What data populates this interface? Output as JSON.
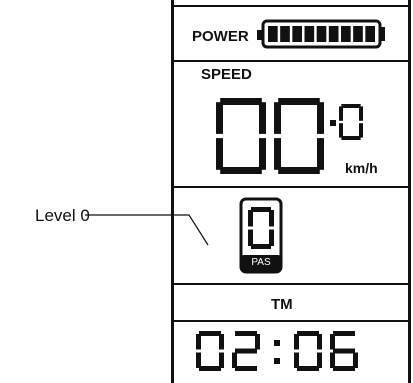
{
  "power": {
    "label": "POWER",
    "bar_segments": 9,
    "level_fraction": 1.0
  },
  "speed": {
    "label": "SPEED",
    "integer_digits": "00",
    "decimal_digit": "0",
    "unit": "km/h"
  },
  "pas": {
    "digit": "0",
    "label": "PAS"
  },
  "callout": {
    "text": "Level 0"
  },
  "trip_time": {
    "label": "TM",
    "hours": "02",
    "separator": ":",
    "minutes": "06"
  }
}
